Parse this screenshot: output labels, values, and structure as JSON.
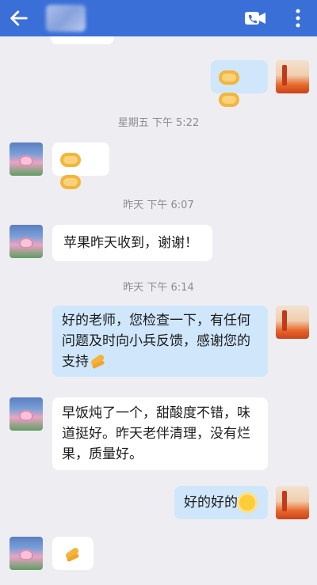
{
  "header": {
    "back_icon": "arrow-left-icon",
    "title_icon": "blurred-contact-name",
    "video_icon": "video-call-icon",
    "more_icon": "more-vertical-icon",
    "bg_color": "#3a6fd8"
  },
  "messages": {
    "m1_emoji": "handshake handshake",
    "ts1": "星期五  下午 5:22",
    "m2_emoji": "handshake handshake",
    "ts2": "昨天  下午 6:07",
    "m3_text": "苹果昨天收到，谢谢！",
    "ts3": "昨天  下午 6:14",
    "m4_line1": "好的老师，您检查一下，有任何",
    "m4_line2": "问题及时向小兵反馈，感谢您的",
    "m4_line3": "支持",
    "m5_line1": "早饭炖了一个，甜酸度不错，味",
    "m5_line2": "道挺好。昨天老伴清理，没有烂",
    "m5_line3": "果，质量好。",
    "m6_text": "好的好的",
    "m7_emoji": "clap"
  },
  "colors": {
    "incoming_bubble": "#ffffff",
    "outgoing_bubble": "#cfe6fb",
    "background": "#ededf2"
  }
}
